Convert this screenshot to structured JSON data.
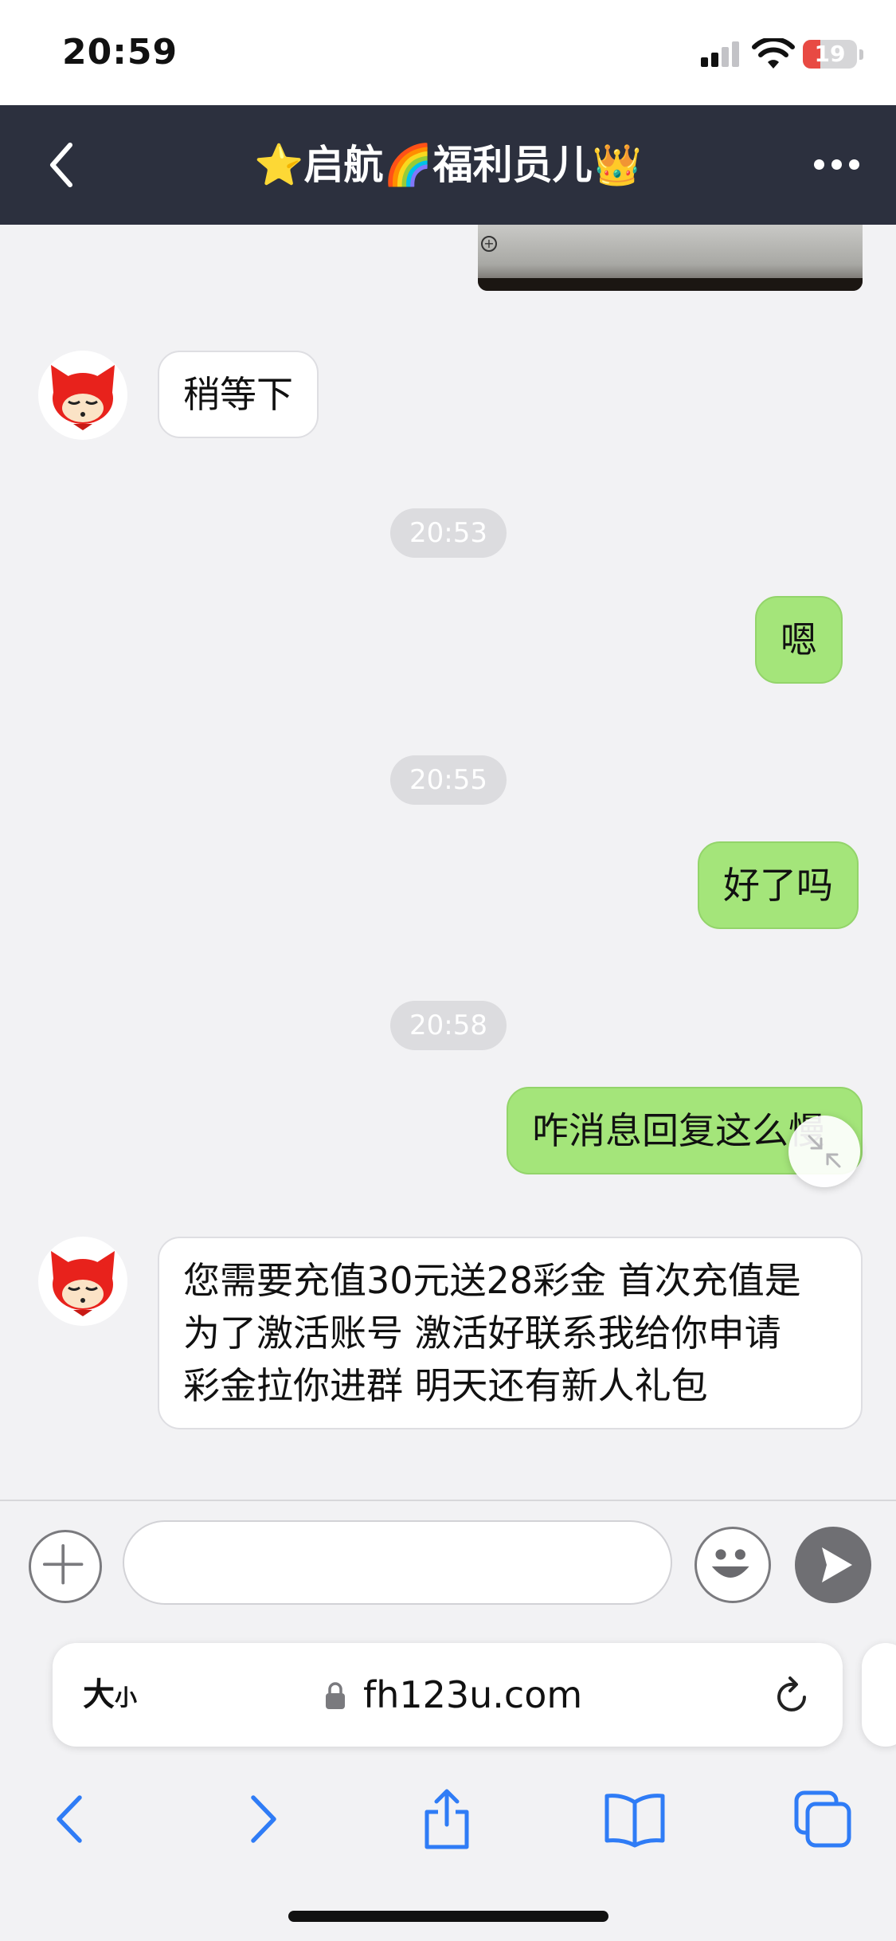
{
  "status_bar": {
    "time": "20:59",
    "battery": "19"
  },
  "header": {
    "title": "⭐启航🌈福利员儿👑"
  },
  "messages": [
    {
      "side": "left",
      "text": "稍等下"
    },
    {
      "timestamp": "20:53"
    },
    {
      "side": "right",
      "text": "嗯"
    },
    {
      "timestamp": "20:55"
    },
    {
      "side": "right",
      "text": "好了吗"
    },
    {
      "timestamp": "20:58"
    },
    {
      "side": "right",
      "text": "咋消息回复这么慢"
    },
    {
      "side": "left",
      "lines": [
        "您需要充值30元送28彩金 首次充值是",
        "为了激活账号 激活好联系我给你申请",
        "彩金拉你进群 明天还有新人礼包"
      ]
    }
  ],
  "input": {
    "value": "",
    "placeholder": ""
  },
  "browser": {
    "text_size_label": "大",
    "text_size_small": "小",
    "url": "fh123u.com"
  },
  "icons": {
    "back": "chevron-left-icon",
    "more": "ellipsis-icon",
    "add": "plus-icon",
    "emoji": "smiley-icon",
    "send": "send-icon",
    "reload": "reload-icon",
    "nav_back": "chevron-left-icon",
    "nav_forward": "chevron-right-icon",
    "share": "share-icon",
    "bookmarks": "book-icon",
    "tabs": "tabs-icon",
    "collapse": "collapse-arrows-icon"
  },
  "colors": {
    "header_bg": "#2c303e",
    "bubble_mine": "#a4e57a",
    "accent_blue": "#2f7cf6",
    "battery_low": "#e84a43"
  }
}
